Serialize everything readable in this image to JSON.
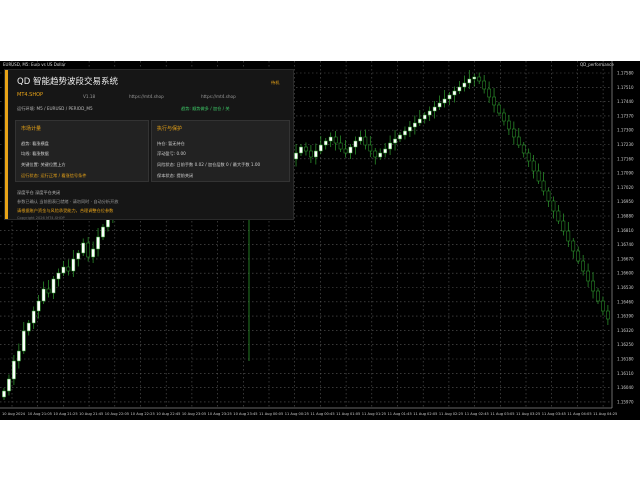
{
  "window": {
    "chart_title": "EURUSD, M5: Euro vs US Dollar",
    "indicator_label": "QD_performance"
  },
  "dashboard": {
    "title": "QD 智能趋势波段交易系统",
    "badge": "待机",
    "brand": "MT4.SHOP",
    "version": "V1.18",
    "site1": "https://mt4.shop",
    "site2": "https://mt4.shop",
    "run_env": "运行环境: M5 / EURUSD / PERIOD_M5",
    "mode_status": "趋势: 顺势做多 / 加仓 / 关",
    "market_card": {
      "header": "市场计量",
      "lines": [
        "趋势: 看涨横盘",
        "均线: 看涨数据",
        "关键位置: 关键位置上方",
        "运行状态: 运行正常 / 看涨信号条件"
      ]
    },
    "exec_card": {
      "header": "执行与保护",
      "lines": [
        "持仓: 暂无持仓",
        "浮动盈亏: 0.00",
        "风险状态: 日前手数 0.02 / 加仓层数 0 / 最大手数 1.00",
        "保本状态: 提前关闭"
      ]
    },
    "footer": {
      "line1": "深度平仓  深度平仓关闭",
      "line2": "参数已确认 当前图表已就绪 · 请勿同时 · 自动分析开放",
      "warn": "请根据账户资金与风险承受能力，合理调整仓位参数",
      "copyright": "Copyright 2026 MT4.SHOP"
    }
  },
  "price_scale": [
    "1.17580",
    "1.17510",
    "1.17440",
    "1.17370",
    "1.17300",
    "1.17230",
    "1.17160",
    "1.17090",
    "1.17020",
    "1.16950",
    "1.16880",
    "1.16810",
    "1.16740",
    "1.16670",
    "1.16600",
    "1.16530",
    "1.16460",
    "1.16390",
    "1.16320",
    "1.16250",
    "1.16180",
    "1.16110",
    "1.16040",
    "1.15970"
  ],
  "time_labels": [
    "10 Aug 2024",
    "10 Aug 21:05",
    "10 Aug 21:25",
    "10 Aug 21:45",
    "10 Aug 22:05",
    "10 Aug 22:25",
    "10 Aug 22:45",
    "10 Aug 23:05",
    "10 Aug 23:25",
    "10 Aug 23:45",
    "11 Aug 00:05",
    "11 Aug 00:25",
    "11 Aug 00:45",
    "11 Aug 01:05",
    "11 Aug 01:25",
    "11 Aug 01:45",
    "11 Aug 02:05",
    "11 Aug 02:25",
    "11 Aug 02:45",
    "11 Aug 03:05",
    "11 Aug 03:25",
    "11 Aug 03:45",
    "11 Aug 04:05",
    "11 Aug 04:25"
  ],
  "colors": {
    "background": "#000000",
    "bull_candle": "#ffffff",
    "bear_candle": "#000000",
    "candle_outline": "#2f9e2f",
    "grid": "#5a5a5a",
    "accent": "#e8a317"
  }
}
